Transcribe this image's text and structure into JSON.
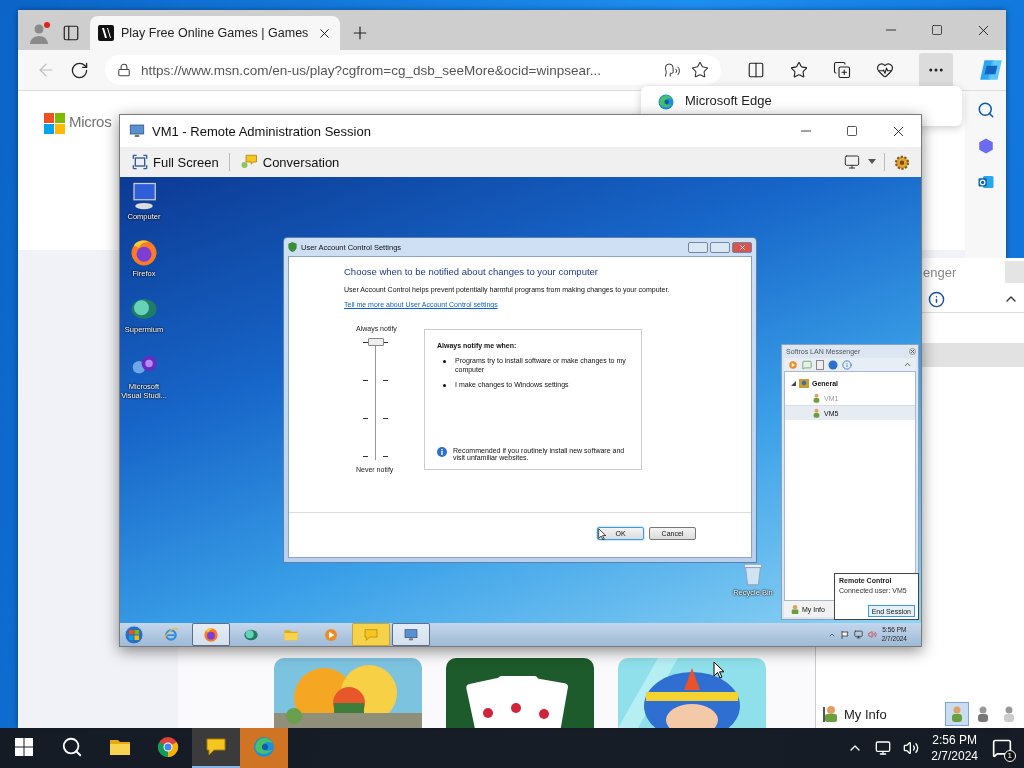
{
  "browser": {
    "tabs": [
      {
        "title": "Play Free Online Games | Games",
        "selected": true
      }
    ],
    "back_disabled": true,
    "url": "https://www.msn.com/en-us/play?cgfrom=cg_dsb_seeMore&ocid=winpsear...",
    "flyout": "Microsoft Edge",
    "logo_text": "Micros"
  },
  "host_messenger": {
    "title": "enger",
    "my_info": "My Info",
    "status_buttons": [
      {
        "selected": true
      },
      {
        "selected": false
      },
      {
        "selected": false
      }
    ]
  },
  "vm_window": {
    "title": "VM1 - Remote Administration Session",
    "toolbar": [
      {
        "kind": "fullscreen",
        "label": "Full Screen"
      },
      {
        "kind": "conversation",
        "label": "Conversation"
      }
    ]
  },
  "vm_desktop": {
    "icons": [
      {
        "kind": "computer",
        "label": "Computer"
      },
      {
        "kind": "firefox",
        "label": "Firefox"
      },
      {
        "kind": "supermium",
        "label": "Supermium"
      },
      {
        "kind": "vstudio",
        "label": "Microsoft Visual Studi..."
      }
    ],
    "recycle_bin": "Recycle Bin"
  },
  "uac": {
    "title": "User Account Control Settings",
    "heading": "Choose when to be notified about changes to your computer",
    "description": "User Account Control helps prevent potentially harmful programs from making changes to your computer.",
    "link": "Tell me more about User Account Control settings",
    "slider": {
      "top_label": "Always notify",
      "bottom_label": "Never notify",
      "level": 1
    },
    "box": {
      "heading": "Always notify me when:",
      "bullets": [
        "Programs try to install software or make changes to my computer",
        "I make changes to Windows settings"
      ],
      "note": "Recommended if you routinely install new software and visit unfamiliar websites."
    },
    "buttons": [
      {
        "label": "OK",
        "default": true
      },
      {
        "label": "Cancel",
        "default": false
      }
    ]
  },
  "messenger": {
    "title": "Softros LAN Messenger",
    "groups": [
      {
        "name": "General",
        "expanded": true,
        "children": [
          {
            "name": "VM1",
            "online": false,
            "selected": false
          },
          {
            "name": "VM5",
            "online": true,
            "selected": true
          }
        ]
      }
    ],
    "my_info": "My Info"
  },
  "remote_popup": {
    "title": "Remote Control",
    "status": "Connected user: VM5",
    "button": "End Session"
  },
  "vm_taskbar": {
    "apps": [
      {
        "kind": "ie",
        "selected": false,
        "flashing": false
      },
      {
        "kind": "firefox",
        "selected": true,
        "flashing": false
      },
      {
        "kind": "supermium",
        "selected": false,
        "flashing": false
      },
      {
        "kind": "explorer",
        "selected": false,
        "flashing": false
      },
      {
        "kind": "media",
        "selected": false,
        "flashing": false
      },
      {
        "kind": "messenger",
        "selected": false,
        "flashing": true
      },
      {
        "kind": "remote",
        "selected": true,
        "flashing": false
      }
    ],
    "time": "5:56 PM",
    "date": "2/7/2024"
  },
  "taskbar": {
    "apps": [
      {
        "kind": "explorer",
        "selected": false,
        "flashing": false
      },
      {
        "kind": "chrome",
        "selected": false,
        "flashing": false
      },
      {
        "kind": "messenger",
        "selected": true,
        "flashing": false
      },
      {
        "kind": "edge",
        "selected": false,
        "flashing": true
      }
    ],
    "time": "2:56 PM",
    "date": "2/7/2024",
    "notifications": "1"
  }
}
